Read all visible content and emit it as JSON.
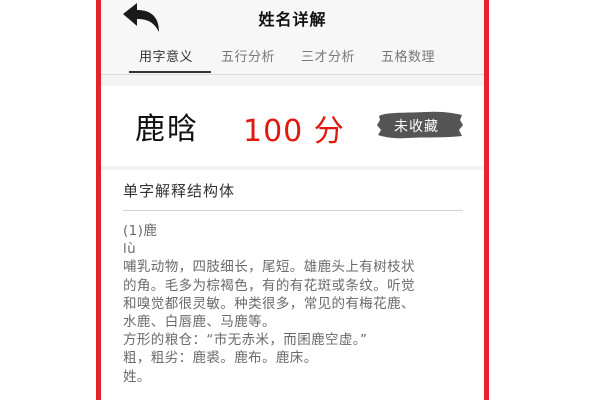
{
  "header": {
    "title": "姓名详解"
  },
  "tabs": [
    {
      "label": "用字意义",
      "active": true
    },
    {
      "label": "五行分析",
      "active": false
    },
    {
      "label": "三才分析",
      "active": false
    },
    {
      "label": "五格数理",
      "active": false
    }
  ],
  "result": {
    "name": "鹿晗",
    "score": "100 分",
    "collect_label": "未收藏"
  },
  "explanation": {
    "title": "单字解释结构体",
    "lines": [
      "(1)鹿",
      "lù",
      "哺乳动物，四肢细长，尾短。雄鹿头上有树枝状",
      "的角。毛多为棕褐色，有的有花斑或条纹。听觉",
      "和嗅觉都很灵敏。种类很多，常见的有梅花鹿、",
      "水鹿、白唇鹿、马鹿等。",
      "方形的粮仓：“市无赤米，而囷鹿空虚。”",
      "粗，粗劣：鹿裘。鹿布。鹿床。",
      "姓。"
    ]
  },
  "colors": {
    "frame": "#e8222c",
    "score": "#e0180f",
    "collect_bg": "#555555"
  },
  "icons": {
    "back": "back-arrow-icon"
  }
}
